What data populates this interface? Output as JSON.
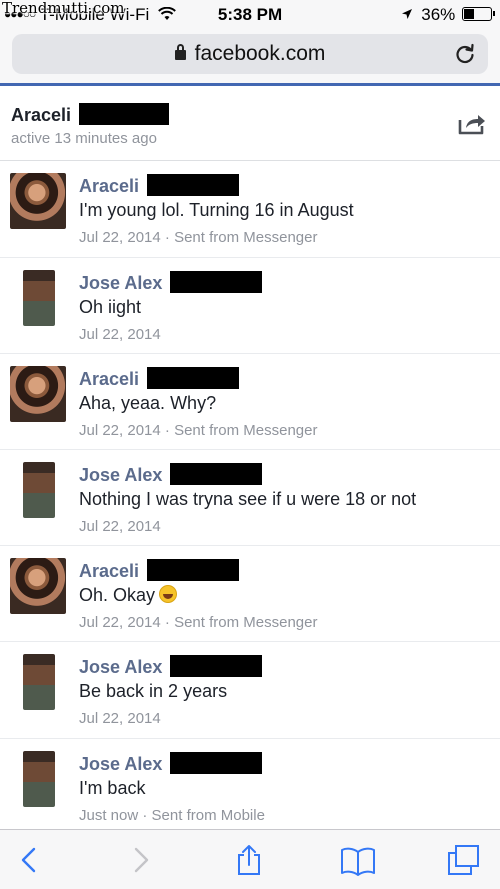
{
  "status_bar": {
    "carrier": "T-Mobile",
    "wifi": "Wi-Fi",
    "time": "5:38 PM",
    "battery": "36%",
    "battery_level": 0.36,
    "watermark": "Trendmutti.com"
  },
  "browser": {
    "url": "facebook.com",
    "icons": [
      "lock-icon",
      "reload-icon"
    ]
  },
  "conversation": {
    "name": "Araceli",
    "status": "active 13 minutes ago",
    "share_icon": "share-icon"
  },
  "messages": [
    {
      "sender": "Araceli",
      "text": "I'm young lol. Turning 16 in August",
      "date": "Jul 22, 2014",
      "source": "Sent from Messenger"
    },
    {
      "sender": "Jose Alex",
      "text": "Oh iight",
      "date": "Jul 22, 2014",
      "source": ""
    },
    {
      "sender": "Araceli",
      "text": "Aha, yeaa. Why?",
      "date": "Jul 22, 2014",
      "source": "Sent from Messenger"
    },
    {
      "sender": "Jose Alex",
      "text": "Nothing I was tryna see if u were 18 or not",
      "date": "Jul 22, 2014",
      "source": ""
    },
    {
      "sender": "Araceli",
      "text": "Oh. Okay",
      "date": "Jul 22, 2014",
      "source": "Sent from Messenger"
    },
    {
      "sender": "Jose Alex",
      "text": "Be back in 2 years",
      "date": "Jul 22, 2014",
      "source": ""
    },
    {
      "sender": "Jose Alex",
      "text": "I'm back",
      "date": "Just now",
      "source": "Sent from Mobile"
    }
  ],
  "toolbar": {
    "icons": [
      "back-icon",
      "forward-icon",
      "share-icon",
      "bookmarks-icon",
      "tabs-icon"
    ],
    "accent": "#3478f6"
  },
  "colors": {
    "facebook_blue": "#4267b2",
    "sender_name": "#5b6b8c",
    "meta_gray": "#90949c"
  }
}
